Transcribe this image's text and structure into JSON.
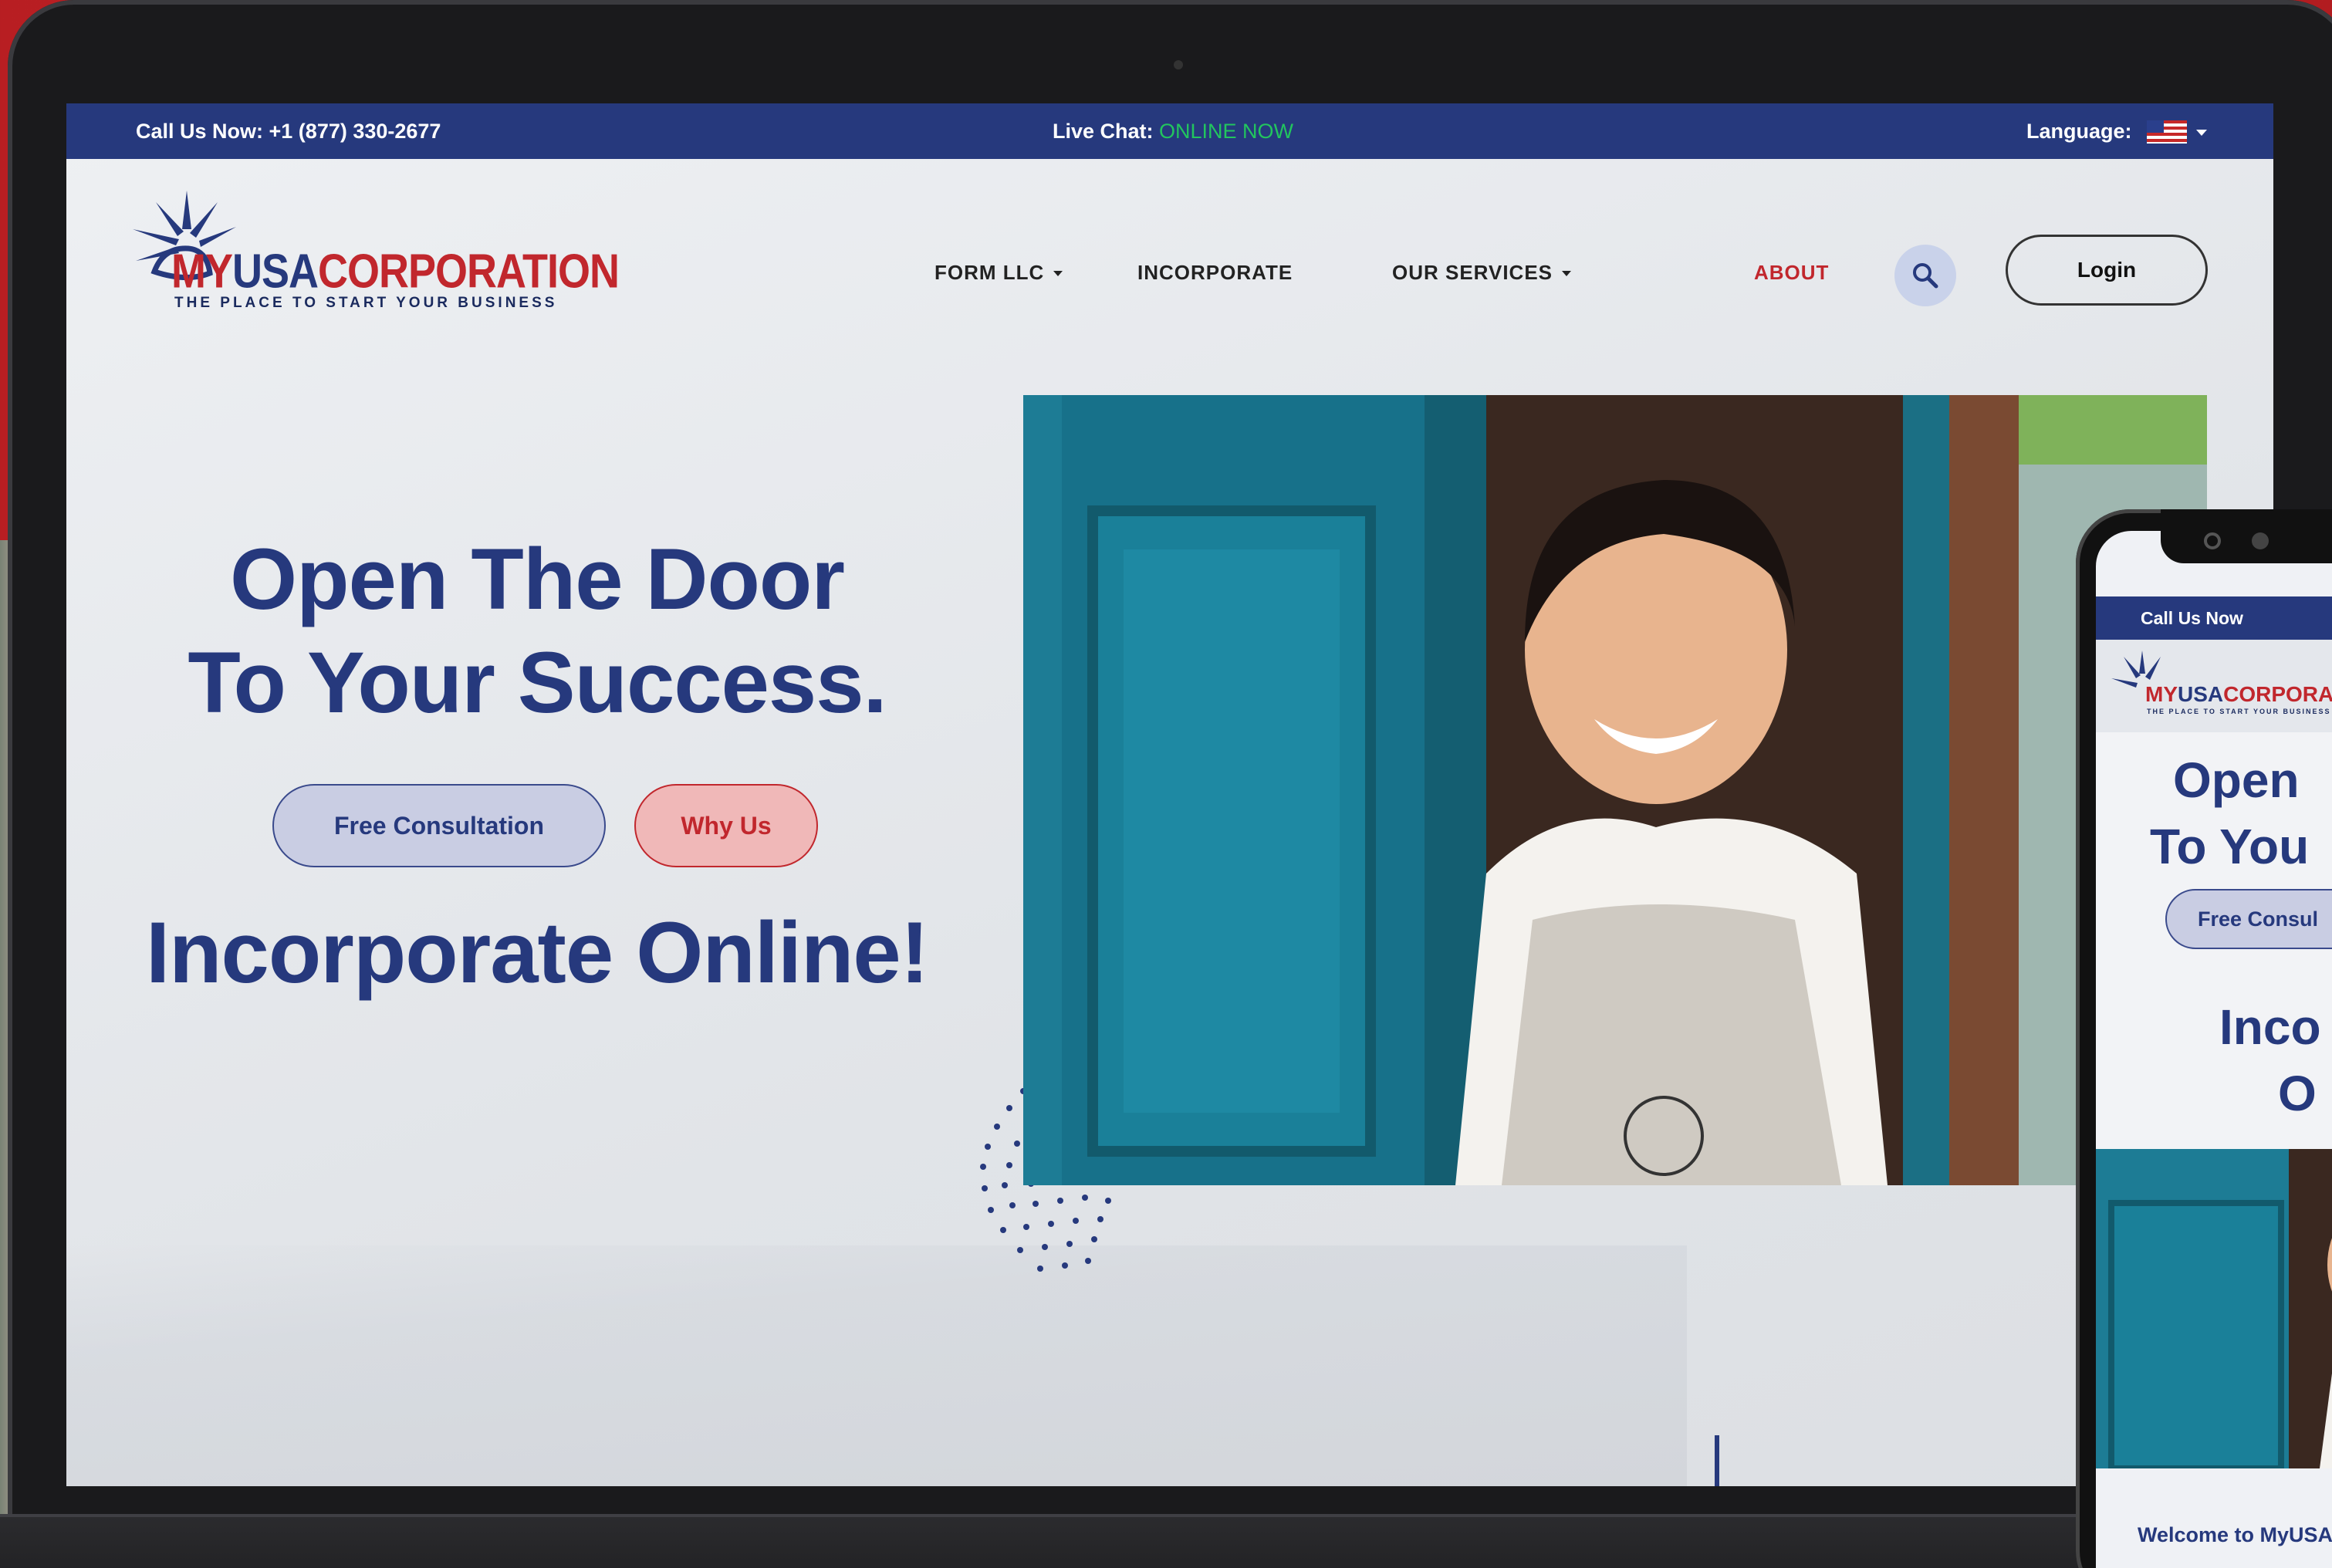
{
  "topbar": {
    "call": "Call Us Now: +1 (877) 330-2677",
    "chat_label": "Live Chat: ",
    "chat_status": "ONLINE NOW",
    "language_label": "Language:"
  },
  "brand": {
    "name_my": "MY",
    "name_usa": "USA",
    "name_corp": "CORPORATION",
    "tagline": "THE PLACE TO START YOUR BUSINESS",
    "primary_color": "#26397d",
    "accent_color": "#c1272d"
  },
  "nav": {
    "items": [
      {
        "label": "FORM LLC",
        "dropdown": true
      },
      {
        "label": "INCORPORATE",
        "dropdown": false
      },
      {
        "label": "OUR SERVICES",
        "dropdown": true
      },
      {
        "label": "ABOUT",
        "dropdown": false
      }
    ],
    "login": "Login"
  },
  "hero": {
    "title_line1": "Open The Door",
    "title_line2": "To Your Success.",
    "btn_consult": "Free Consultation",
    "btn_why": "Why Us",
    "subtitle": "Incorporate Online!"
  },
  "phone": {
    "call": "Call Us Now",
    "brand_my": "MY",
    "brand_usa": "USA",
    "brand_corp": "CORPORATION",
    "brand_tagline": "THE PLACE TO START YOUR BUSINESS",
    "title_line1": "Open",
    "title_line2": "To You",
    "btn_consult": "Free Consul",
    "sub_line1": "Inco",
    "sub_line2": "O",
    "welcome": "Welcome to MyUSA"
  }
}
